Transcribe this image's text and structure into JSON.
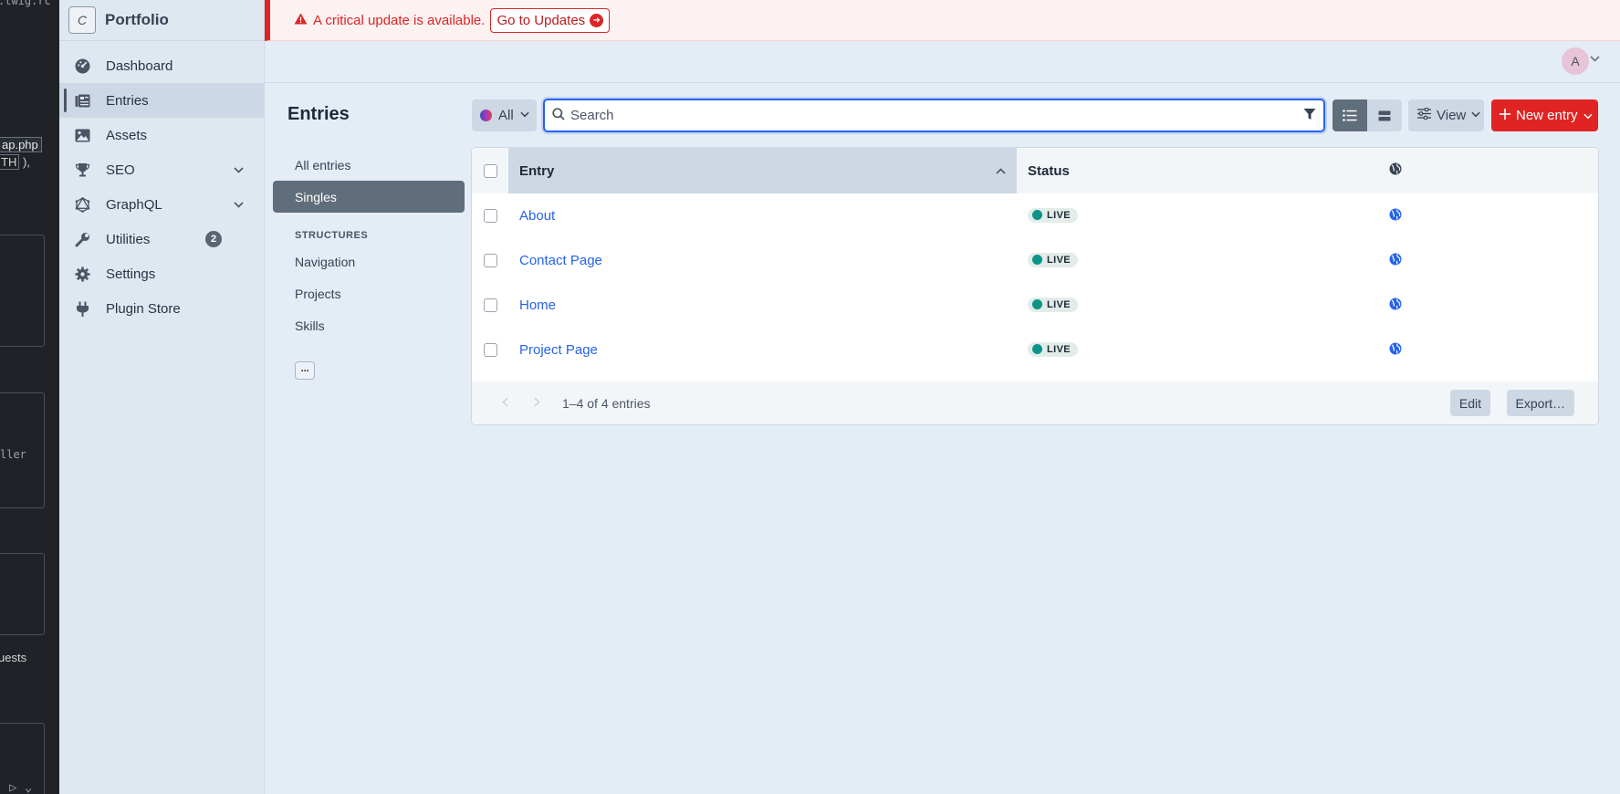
{
  "editor": {
    "snippet_top": ".twig.rc",
    "snippet_file": "ap.php",
    "snippet_const": "TH",
    "snippet_const_tail": "),",
    "snippet_code": "ller",
    "snippet_requests": "uests"
  },
  "site": {
    "logo_letter": "C",
    "name": "Portfolio"
  },
  "nav": [
    {
      "label": "Dashboard",
      "icon": "dashboard-icon"
    },
    {
      "label": "Entries",
      "icon": "entries-icon",
      "active": true
    },
    {
      "label": "Assets",
      "icon": "image-icon"
    },
    {
      "label": "SEO",
      "icon": "trophy-icon",
      "has_chevron": true
    },
    {
      "label": "GraphQL",
      "icon": "graphql-icon",
      "has_chevron": true
    },
    {
      "label": "Utilities",
      "icon": "wrench-icon",
      "badge": "2"
    },
    {
      "label": "Settings",
      "icon": "gear-icon"
    },
    {
      "label": "Plugin Store",
      "icon": "plug-icon"
    }
  ],
  "alert": {
    "message": "A critical update is available.",
    "button": "Go to Updates"
  },
  "user": {
    "avatar_letter": "A"
  },
  "page": {
    "title": "Entries"
  },
  "sources": {
    "items": [
      "All entries",
      "Singles"
    ],
    "selected": "Singles",
    "heading": "STRUCTURES",
    "structures": [
      "Navigation",
      "Projects",
      "Skills"
    ],
    "more_label": "···"
  },
  "toolbar": {
    "site_label": "All",
    "search_placeholder": "Search",
    "view_label": "View",
    "new_entry_label": "New entry"
  },
  "table": {
    "columns": {
      "entry": "Entry",
      "status": "Status"
    },
    "rows": [
      {
        "title": "About",
        "status": "LIVE"
      },
      {
        "title": "Contact Page",
        "status": "LIVE"
      },
      {
        "title": "Home",
        "status": "LIVE"
      },
      {
        "title": "Project Page",
        "status": "LIVE"
      }
    ],
    "count_text": "1–4 of 4 entries",
    "edit_label": "Edit",
    "export_label": "Export…"
  },
  "colors": {
    "accent": "#e02424",
    "link": "#2563eb",
    "live": "#0d9488",
    "sidebar_bg": "#dfe7f1"
  }
}
